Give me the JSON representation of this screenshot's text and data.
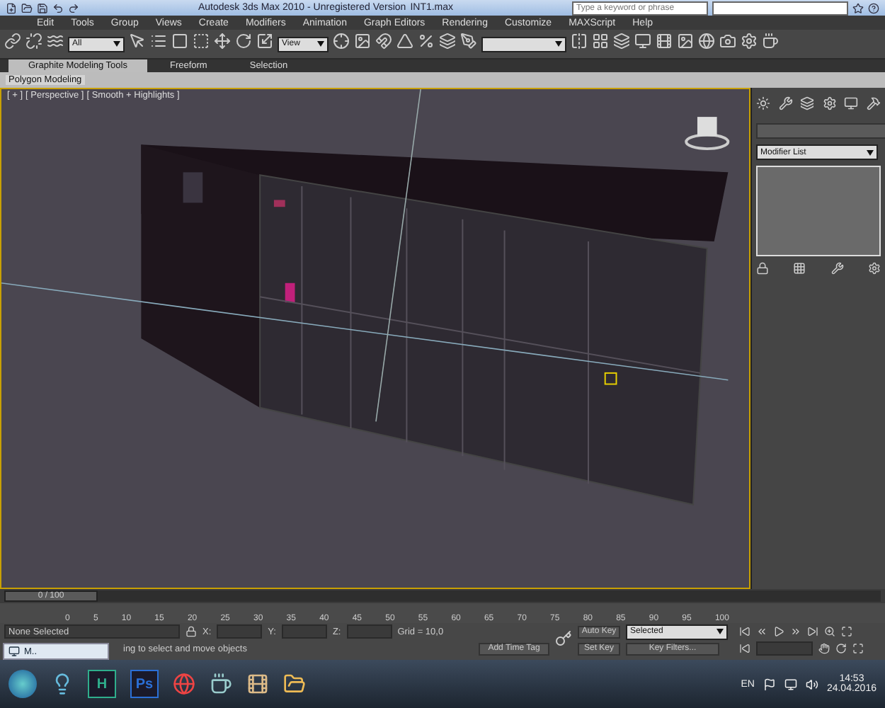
{
  "window": {
    "title": "Autodesk 3ds Max 2010",
    "version": "- Unregistered Version",
    "file": "INT1.max"
  },
  "search": {
    "placeholder": "Type a keyword or phrase"
  },
  "menu": [
    "Edit",
    "Tools",
    "Group",
    "Views",
    "Create",
    "Modifiers",
    "Animation",
    "Graph Editors",
    "Rendering",
    "Customize",
    "MAXScript",
    "Help"
  ],
  "toolbar": {
    "selection_filter": "All",
    "reference_coord": "View"
  },
  "ribbon": {
    "tabs": [
      {
        "label": "Graphite Modeling Tools",
        "selected": true
      },
      {
        "label": "Freeform",
        "selected": false
      },
      {
        "label": "Selection",
        "selected": false
      }
    ],
    "panel": "Polygon Modeling"
  },
  "viewport": {
    "labels": [
      "[ + ]",
      "[ Perspective ]",
      "[ Smooth + Highlights ]"
    ]
  },
  "command_panel": {
    "modifier_list": "Modifier List"
  },
  "time_slider": {
    "position": "0 / 100",
    "level": 0
  },
  "track_ticks": [
    "0",
    "5",
    "10",
    "15",
    "20",
    "25",
    "30",
    "35",
    "40",
    "45",
    "50",
    "55",
    "60",
    "65",
    "70",
    "75",
    "80",
    "85",
    "90",
    "95",
    "100"
  ],
  "status": {
    "selection": "None Selected",
    "x_label": "X:",
    "y_label": "Y:",
    "z_label": "Z:",
    "grid": "Grid = 10,0",
    "prompt": "ing to select and move objects",
    "add_time_tag": "Add Time Tag"
  },
  "animation": {
    "auto_key": "Auto Key",
    "key_mode": "Selected",
    "set_key": "Set Key",
    "key_filters": "Key Filters..."
  },
  "preview": {
    "title": "M.."
  },
  "taskbar": {
    "apps": [
      {
        "label": "H",
        "color": "#2fae8c"
      },
      {
        "label": "Ps",
        "color": "#2b6fd6"
      }
    ],
    "language": "EN",
    "time": "14:53",
    "date": "24.04.2016"
  }
}
